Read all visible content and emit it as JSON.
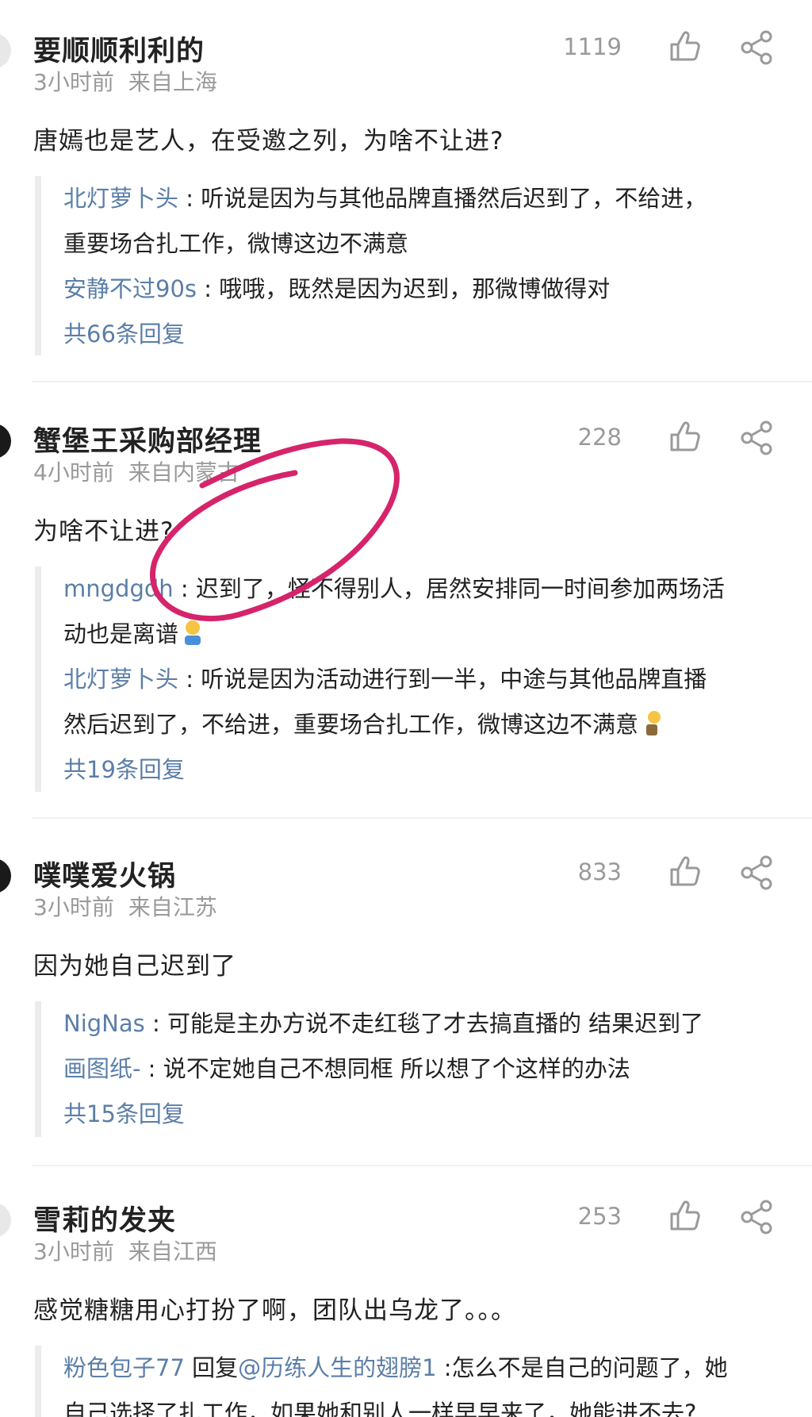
{
  "comments": [
    {
      "username": "要顺顺利利的",
      "time": "3小时前",
      "location": "来自上海",
      "likes": "1119",
      "text": "唐嫣也是艺人，在受邀之列，为啥不让进?",
      "replies": [
        {
          "name": "北灯萝卜头",
          "sep": " : ",
          "line1": "听说是因为与其他品牌直播然后迟到了，不给进，",
          "line2": "重要场合扎工作，微博这边不满意"
        },
        {
          "name": "安静不过90s",
          "sep": " : ",
          "line1": "哦哦，既然是因为迟到，那微博做得对"
        }
      ],
      "reply_count": "共66条回复"
    },
    {
      "username": "蟹堡王采购部经理",
      "time": "4小时前",
      "location": "来自内蒙古",
      "likes": "228",
      "text": "为啥不让进?",
      "replies": [
        {
          "name": "mngdgdh",
          "sep": " : ",
          "line1": "迟到了，怪不得别人，居然安排同一时间参加两场活",
          "line2": "动也是离谱"
        },
        {
          "name": "北灯萝卜头",
          "sep": " : ",
          "line1": "听说是因为活动进行到一半，中途与其他品牌直播",
          "line2": "然后迟到了，不给进，重要场合扎工作，微博这边不满意"
        }
      ],
      "reply_count": "共19条回复"
    },
    {
      "username": "噗噗爱火锅",
      "time": "3小时前",
      "location": "来自江苏",
      "likes": "833",
      "text": "因为她自己迟到了",
      "replies": [
        {
          "name": "NigNas",
          "sep": " : ",
          "line1": "可能是主办方说不走红毯了才去搞直播的 结果迟到了"
        },
        {
          "name": "画图纸-",
          "sep": " : ",
          "line1": "说不定她自己不想同框 所以想了个这样的办法"
        }
      ],
      "reply_count": "共15条回复"
    },
    {
      "username": "雪莉的发夹",
      "time": "3小时前",
      "location": "来自江西",
      "likes": "253",
      "text": "感觉糖糖用心打扮了啊，团队出乌龙了。。。",
      "replies": [
        {
          "name": "粉色包子77",
          "reply_word": " 回复",
          "mention": "@历练人生的翅膀1",
          "sep": " :",
          "line1": "怎么不是自己的问题了，她",
          "line2": "自己选择了扎工作，如果她和别人一样早早来了，她能进不去?"
        }
      ]
    }
  ],
  "colors": {
    "link": "#5b7ea8",
    "meta": "#9a9a9a",
    "annotation": "#d6246b"
  },
  "icons": [
    "thumbs-up-icon",
    "share-icon"
  ]
}
